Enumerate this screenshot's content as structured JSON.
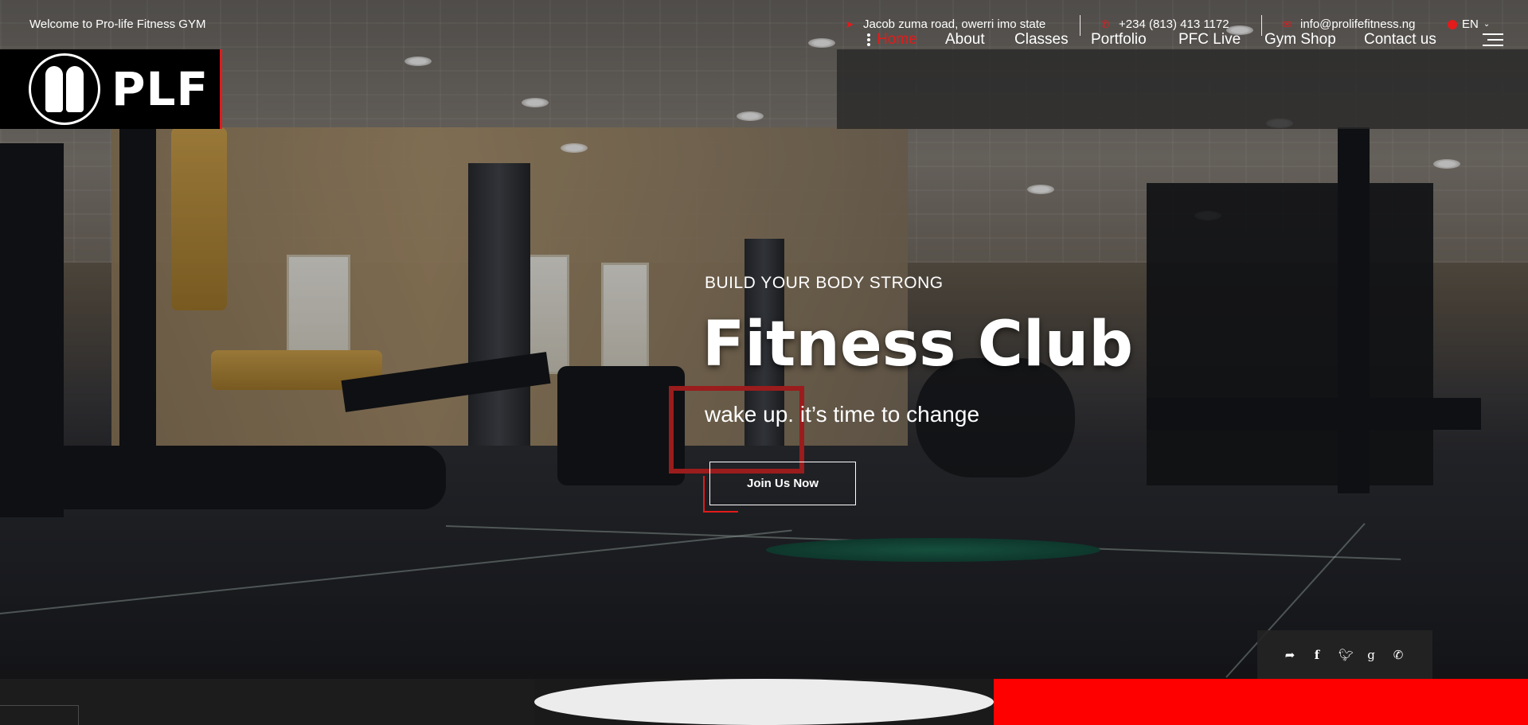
{
  "topbar": {
    "welcome": "Welcome to Pro-life Fitness GYM",
    "address": "Jacob zuma road, owerri imo state",
    "phone": "+234 (813) 413 1172",
    "email": "info@prolifefitness.ng",
    "language": "EN",
    "address_icon": "location-arrow-icon",
    "phone_icon": "phone-icon",
    "email_icon": "envelope-icon",
    "language_icon": "globe-icon"
  },
  "logo": {
    "text": "PLF"
  },
  "nav": {
    "items": [
      {
        "label": "Home",
        "active": true
      },
      {
        "label": "About"
      },
      {
        "label": "Classes"
      },
      {
        "label": "Portfolio"
      },
      {
        "label": "PFC Live"
      },
      {
        "label": "Gym Shop"
      },
      {
        "label": "Contact us"
      }
    ],
    "menu_icon": "hamburger-icon"
  },
  "hero": {
    "subtitle": "BUILD YOUR BODY STRONG",
    "title": "Fitness Club",
    "tagline": "wake up. it’s time to change",
    "cta": "Join Us Now"
  },
  "social": {
    "icons": [
      "share-icon",
      "facebook-icon",
      "twitter-icon",
      "google-plus-icon",
      "whatsapp-icon"
    ]
  },
  "colors": {
    "accent": "#e31b1b",
    "nav_bg": "#282828",
    "strip_dark": "#1c1c1c",
    "strip_light": "#ececec",
    "strip_red": "#ff0000"
  }
}
